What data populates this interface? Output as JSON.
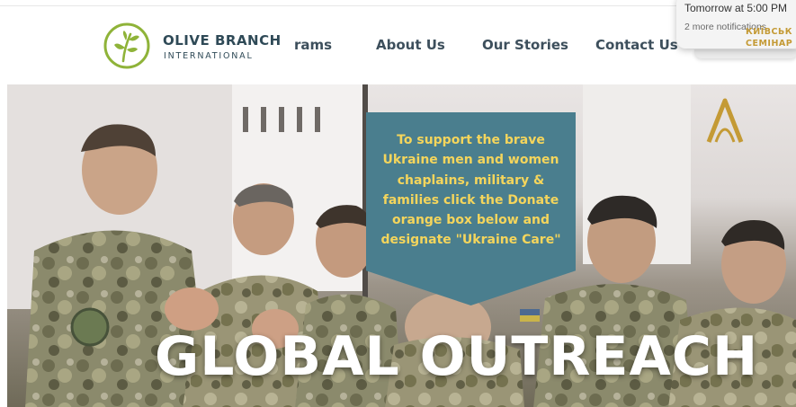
{
  "brand": {
    "name": "OLIVE BRANCH",
    "subtitle": "INTERNATIONAL",
    "icon": "olive-branch-logo"
  },
  "nav": {
    "items": [
      {
        "label": "rams"
      },
      {
        "label": "About Us"
      },
      {
        "label": "Our Stories"
      },
      {
        "label": "Contact Us"
      }
    ]
  },
  "notification": {
    "line1": "Tomorrow at 5:00 PM",
    "line2": "2 more notifications"
  },
  "hero": {
    "callout": "To support the brave Ukraine men and women chaplains, military & families click the Donate orange box below and designate \"Ukraine Care\"",
    "title": "GLOBAL OUTREACH",
    "seminary_line1": "КИЇВСЬК",
    "seminary_line2": "СЕМІНАР"
  },
  "colors": {
    "logo_green": "#8fb339",
    "brand_text": "#2f4a57",
    "nav_text": "#3d4f5c",
    "callout_bg": "#4a7e8e",
    "callout_text": "#f4d55c",
    "seminary_gold": "#c49a35"
  }
}
